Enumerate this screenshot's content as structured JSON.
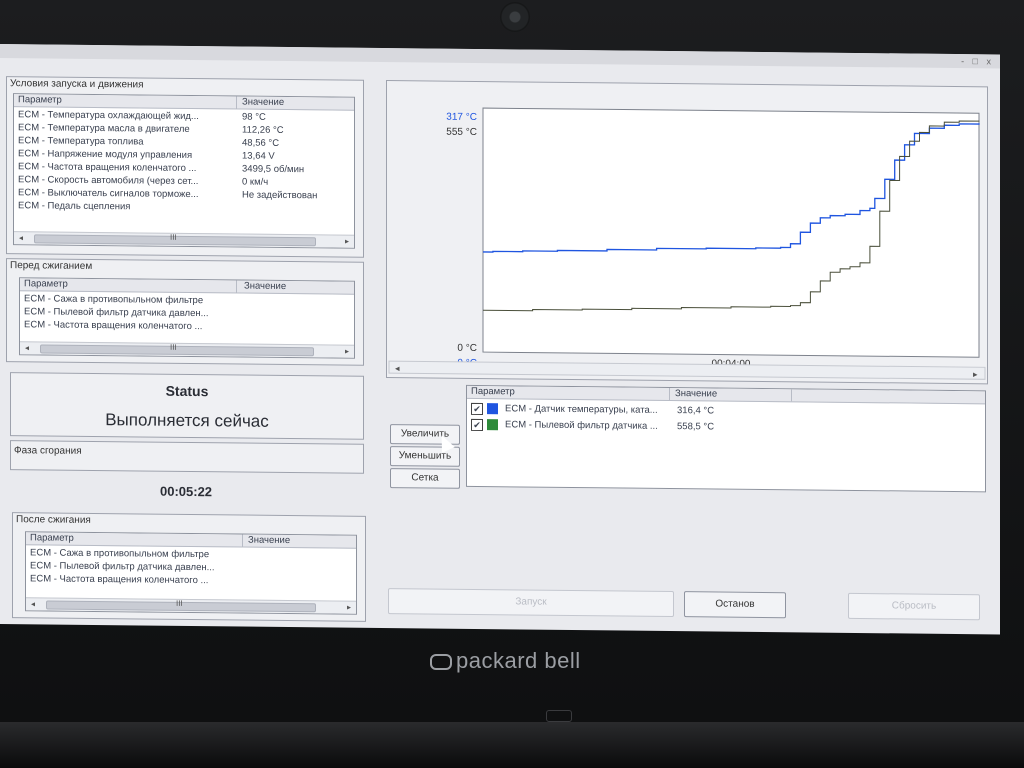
{
  "window": {
    "title": "",
    "controls": "- □ x"
  },
  "panels": {
    "start_conditions": {
      "title": "Условия запуска и движения",
      "headers": [
        "Параметр",
        "Значение"
      ],
      "rows": [
        [
          "ECM - Температура охлаждающей жид...",
          "98 °C"
        ],
        [
          "ECM - Температура масла в двигателе",
          "112,26 °C"
        ],
        [
          "ECM - Температура топлива",
          "48,56 °C"
        ],
        [
          "ECM - Напряжение модуля управления",
          "13,64 V"
        ],
        [
          "ECM - Частота вращения коленчатого ...",
          "3499,5 об/мин"
        ],
        [
          "ECM - Скорость автомобиля (через сет...",
          "0 км/ч"
        ],
        [
          "ECM - Выключатель сигналов торможе...",
          "Не задействован"
        ],
        [
          "ECM - Педаль сцепления",
          ""
        ]
      ],
      "scroll_grip": "III"
    },
    "before_burn": {
      "title": "Перед сжиганием",
      "headers": [
        "Параметр",
        "Значение"
      ],
      "rows": [
        [
          "ECM - Сажа в противопыльном фильтре",
          ""
        ],
        [
          "ECM - Пылевой фильтр датчика давлен...",
          ""
        ],
        [
          "ECM - Частота вращения коленчатого ...",
          ""
        ]
      ],
      "scroll_grip": "III"
    },
    "status": {
      "title": "Status",
      "text": "Выполняется сейчас"
    },
    "phase": {
      "title": "Фаза сгорания",
      "timer": "00:05:22"
    },
    "after_burn": {
      "title": "После сжигания",
      "headers": [
        "Параметр",
        "Значение"
      ],
      "rows": [
        [
          "ECM - Сажа в противопыльном фильтре",
          ""
        ],
        [
          "ECM - Пылевой фильтр датчика давлен...",
          ""
        ],
        [
          "ECM - Частота вращения коленчатого ...",
          ""
        ]
      ],
      "scroll_grip": "III"
    }
  },
  "chart_buttons": {
    "zoom_in": "Увеличить",
    "zoom_out": "Уменьшить",
    "grid": "Сетка"
  },
  "legend": {
    "headers": [
      "Параметр",
      "Значение"
    ],
    "rows": [
      {
        "name": "ECM - Датчик температуры, ката...",
        "value": "316,4 °C",
        "color": "#1f55e0",
        "checked": true
      },
      {
        "name": "ECM - Пылевой фильтр датчика ...",
        "value": "558,5 °C",
        "color": "#2e8b3a",
        "checked": true
      }
    ]
  },
  "bottom_buttons": {
    "start": "Запуск",
    "stop": "Останов",
    "reset": "Сбросить"
  },
  "brand": "packard bell",
  "chart_data": {
    "type": "line",
    "x_label_center": "00:04:00",
    "y_top_labels": [
      "317 °C",
      "555 °C"
    ],
    "y_bottom_labels": [
      "0 °C",
      "0 °C"
    ],
    "series": [
      {
        "name": "ECM - Датчик температуры, ката...",
        "color": "#1f55e0",
        "ylim": [
          0,
          317
        ],
        "points": [
          [
            0,
            130
          ],
          [
            0.02,
            131
          ],
          [
            0.08,
            132
          ],
          [
            0.15,
            133
          ],
          [
            0.25,
            135
          ],
          [
            0.35,
            137
          ],
          [
            0.45,
            138
          ],
          [
            0.55,
            139
          ],
          [
            0.6,
            140
          ],
          [
            0.62,
            145
          ],
          [
            0.64,
            160
          ],
          [
            0.66,
            172
          ],
          [
            0.68,
            179
          ],
          [
            0.7,
            182
          ],
          [
            0.73,
            184
          ],
          [
            0.76,
            189
          ],
          [
            0.78,
            192
          ],
          [
            0.79,
            205
          ],
          [
            0.81,
            230
          ],
          [
            0.83,
            255
          ],
          [
            0.85,
            275
          ],
          [
            0.87,
            290
          ],
          [
            0.9,
            297
          ],
          [
            0.93,
            301
          ],
          [
            0.96,
            303
          ],
          [
            1.0,
            304
          ]
        ]
      },
      {
        "name": "ECM - Пылевой фильтр датчика ...",
        "color": "#2e8b3a",
        "ylim": [
          0,
          555
        ],
        "points": [
          [
            0,
            95
          ],
          [
            0.1,
            98
          ],
          [
            0.2,
            100
          ],
          [
            0.3,
            103
          ],
          [
            0.4,
            106
          ],
          [
            0.5,
            109
          ],
          [
            0.58,
            111
          ],
          [
            0.62,
            113
          ],
          [
            0.64,
            120
          ],
          [
            0.66,
            145
          ],
          [
            0.68,
            170
          ],
          [
            0.7,
            190
          ],
          [
            0.72,
            198
          ],
          [
            0.74,
            203
          ],
          [
            0.76,
            212
          ],
          [
            0.78,
            250
          ],
          [
            0.8,
            330
          ],
          [
            0.82,
            400
          ],
          [
            0.84,
            455
          ],
          [
            0.86,
            490
          ],
          [
            0.88,
            510
          ],
          [
            0.9,
            525
          ],
          [
            0.93,
            534
          ],
          [
            0.96,
            537
          ],
          [
            1.0,
            538
          ]
        ]
      }
    ]
  }
}
